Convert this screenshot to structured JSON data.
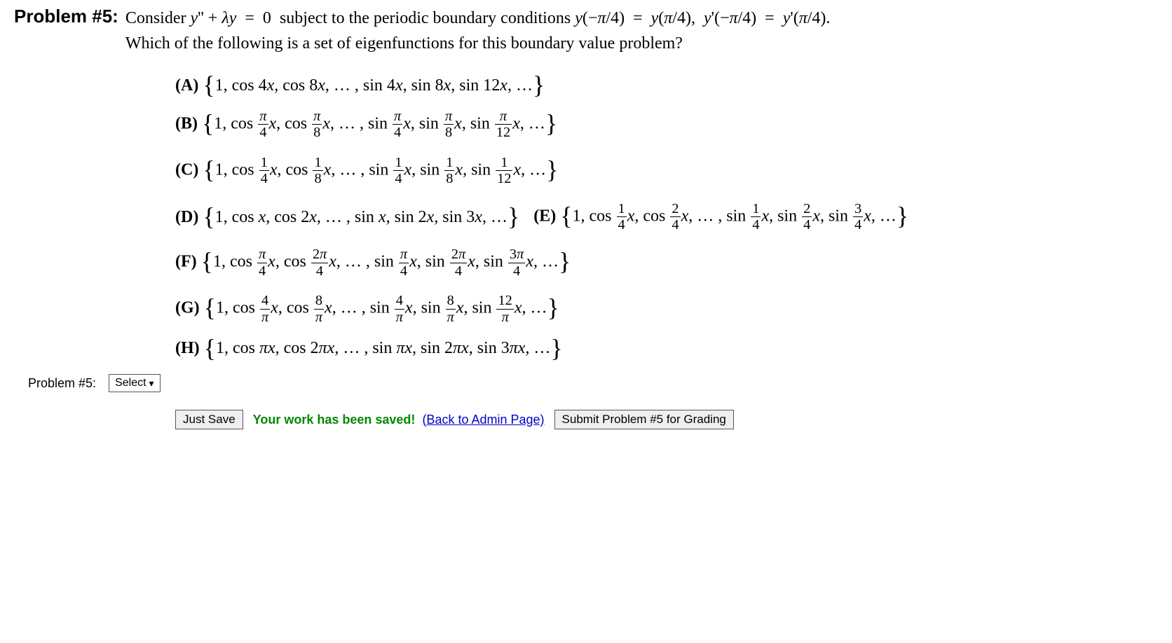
{
  "problem": {
    "label": "Problem #5:",
    "text1": "Consider ",
    "equation": "y'' + λy = 0",
    "text2": " subject to the periodic boundary conditions ",
    "bc": "y(−π/4) = y(π/4), y'(−π/4) = y'(π/4).",
    "text3": "Which of the following is a set of eigenfunctions for this boundary value problem?"
  },
  "options": {
    "A": {
      "label": "(A)",
      "content": "{1, cos 4x, cos 8x, … , sin 4x, sin 8x, sin 12x, …}",
      "frequencies_cos": [
        "4",
        "8"
      ],
      "frequencies_sin": [
        "4",
        "8",
        "12"
      ]
    },
    "B": {
      "label": "(B)",
      "content": "{1, cos (π/4)x, cos (π/8)x, … , sin (π/4)x, sin (π/8)x, sin (π/12)x, …}"
    },
    "C": {
      "label": "(C)",
      "content": "{1, cos (1/4)x, cos (1/8)x, … , sin (1/4)x, sin (1/8)x, sin (1/12)x, …}"
    },
    "D": {
      "label": "(D)",
      "content": "{1, cos x, cos 2x, … , sin x, sin 2x, sin 3x, …}"
    },
    "E": {
      "label": "(E)",
      "content": "{1, cos (1/4)x, cos (2/4)x, … , sin (1/4)x, sin (2/4)x, sin (3/4)x, …}"
    },
    "F": {
      "label": "(F)",
      "content": "{1, cos (π/4)x, cos (2π/4)x, … , sin (π/4)x, sin (2π/4)x, sin (3π/4)x, …}"
    },
    "G": {
      "label": "(G)",
      "content": "{1, cos (4/π)x, cos (8/π)x, … , sin (4/π)x, sin (8/π)x, sin (12/π)x, …}"
    },
    "H": {
      "label": "(H)",
      "content": "{1, cos πx, cos 2πx, … , sin πx, sin 2πx, sin 3πx, …}"
    }
  },
  "answer": {
    "label": "Problem #5:",
    "select_text": "Select"
  },
  "buttons": {
    "save": "Just Save",
    "saved_message": "Your work has been saved!",
    "back_link": "(Back to Admin Page)",
    "submit": "Submit Problem #5 for Grading"
  }
}
